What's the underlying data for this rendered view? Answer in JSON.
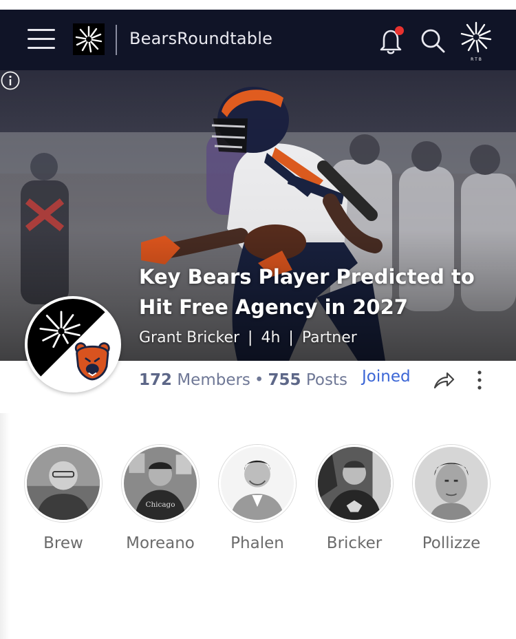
{
  "header": {
    "site_name": "BearsRoundtable",
    "icons": [
      "hamburger-menu-icon",
      "site-logo-icon",
      "bell-icon",
      "search-icon",
      "rtb-logo-icon"
    ],
    "rtb_logo_text": "R T B",
    "notification_dot_color": "#e8322f",
    "background_color": "#101427"
  },
  "hero": {
    "title": "Key Bears Player Predicted to Hit Free Agency in 2027",
    "author": "Grant Bricker",
    "age": "4h",
    "tag": "Partner",
    "separator": "|"
  },
  "community": {
    "members_count": "172",
    "members_label": "Members",
    "dot": "•",
    "posts_count": "755",
    "posts_label": "Posts",
    "joined_label": "Joined",
    "accent_color": "#3b66d6"
  },
  "writers": [
    {
      "name": "Brew"
    },
    {
      "name": "Moreano"
    },
    {
      "name": "Phalen"
    },
    {
      "name": "Bricker"
    },
    {
      "name": "Pollizze"
    }
  ]
}
